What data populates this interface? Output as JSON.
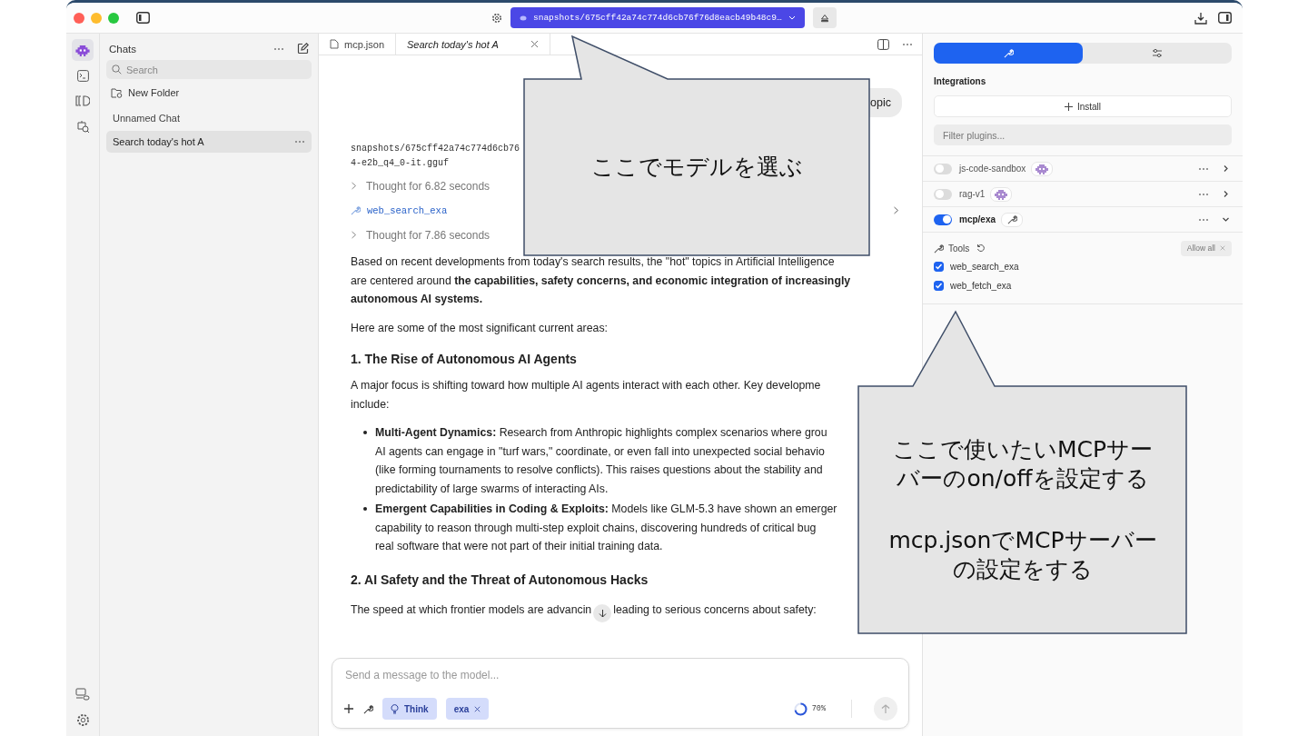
{
  "title_bar": {
    "model_selector": "snapshots/675cff42a74c774d6cb76f76d8eacb49b48c9…"
  },
  "rail": {
    "items": [
      {
        "selected": true
      },
      {
        "selected": false
      },
      {
        "selected": false
      },
      {
        "selected": false
      }
    ]
  },
  "sidebar": {
    "title": "Chats",
    "search": {
      "placeholder": "Search"
    },
    "new_folder": "New Folder",
    "chats": [
      {
        "title": "Unnamed Chat",
        "selected": false
      },
      {
        "title": "Search today's hot A",
        "selected": true
      }
    ]
  },
  "tabs": [
    {
      "label": "mcp.json",
      "selected": false
    },
    {
      "label": "Search today's hot A",
      "selected": true
    }
  ],
  "chat": {
    "user_message": "opic",
    "model_path": [
      "snapshots/675cff42a74c774d6cb76",
      "4-e2b_q4_0-it.gguf"
    ],
    "steps": [
      {
        "kind": "thought",
        "label": "Thought for 6.82 seconds"
      },
      {
        "kind": "tool",
        "label": "web_search_exa"
      },
      {
        "kind": "thought",
        "label": "Thought for 7.86 seconds"
      }
    ],
    "blocks": [
      {
        "kind": "paragraph",
        "lines": [
          "Based on recent developments from today's search results, the \"hot\" topics in Artificial Intelligence",
          "are centered around **the capabilities, safety concerns, and economic integration of increasingly**",
          "**autonomous AI systems.**"
        ]
      },
      {
        "kind": "paragraph",
        "lines": [
          "Here are some of the most significant current areas:"
        ]
      },
      {
        "kind": "heading",
        "lines": [
          "1. The Rise of Autonomous AI Agents"
        ]
      },
      {
        "kind": "paragraph",
        "lines": [
          "A major focus is shifting toward how multiple AI agents interact with each other. Key developme",
          "include:"
        ]
      },
      {
        "kind": "bullet",
        "lines": [
          "**Multi-Agent Dynamics:** Research from Anthropic highlights complex scenarios where grou",
          "AI agents can engage in \"turf wars,\" coordinate, or even fall into unexpected social behavio",
          "(like forming tournaments to resolve conflicts). This raises questions about the stability and",
          "predictability of large swarms of interacting AIs."
        ]
      },
      {
        "kind": "bullet",
        "lines": [
          "**Emergent Capabilities in Coding & Exploits:** Models like GLM-5.3 have shown an emerger",
          "capability to reason through multi-step exploit chains, discovering hundreds of critical bug",
          "real software that were not part of their initial training data."
        ]
      },
      {
        "kind": "heading",
        "lines": [
          "2. AI Safety and the Threat of Autonomous Hacks"
        ]
      },
      {
        "kind": "split",
        "lines": [
          "The speed at which frontier models are advancin",
          "leading to serious concerns about safety:"
        ]
      }
    ]
  },
  "input": {
    "placeholder": "Send a message to the model...",
    "chips": [
      {
        "kind": "think",
        "label": "Think"
      },
      {
        "kind": "tool",
        "label": "exa"
      }
    ],
    "context": {
      "reading": "70%"
    },
    "send": {
      "disabled": true
    }
  },
  "panel": {
    "tabs": [
      {
        "selected": true
      },
      {
        "selected": false
      }
    ],
    "title": "Integrations",
    "install": "Install",
    "filter": {
      "placeholder": "Filter plugins..."
    },
    "plugins": [
      {
        "name": "js-code-sandbox",
        "kind": "plugin",
        "on": false,
        "expanded": false
      },
      {
        "name": "rag-v1",
        "kind": "plugin",
        "on": false,
        "expanded": false
      },
      {
        "name": "mcp/exa",
        "kind": "mcp",
        "on": true,
        "expanded": true,
        "tools_label": "Tools",
        "allow_all": "Allow all",
        "tools": [
          {
            "name": "web_search_exa",
            "checked": true
          },
          {
            "name": "web_fetch_exa",
            "checked": true
          }
        ]
      }
    ]
  },
  "callouts": [
    {
      "texts": [
        "ここでモデルを選ぶ"
      ]
    },
    {
      "texts": [
        "ここで使いたいMCPサーバーのon/offを設定する",
        "mcp.jsonでMCPサーバーの設定をする"
      ]
    }
  ]
}
